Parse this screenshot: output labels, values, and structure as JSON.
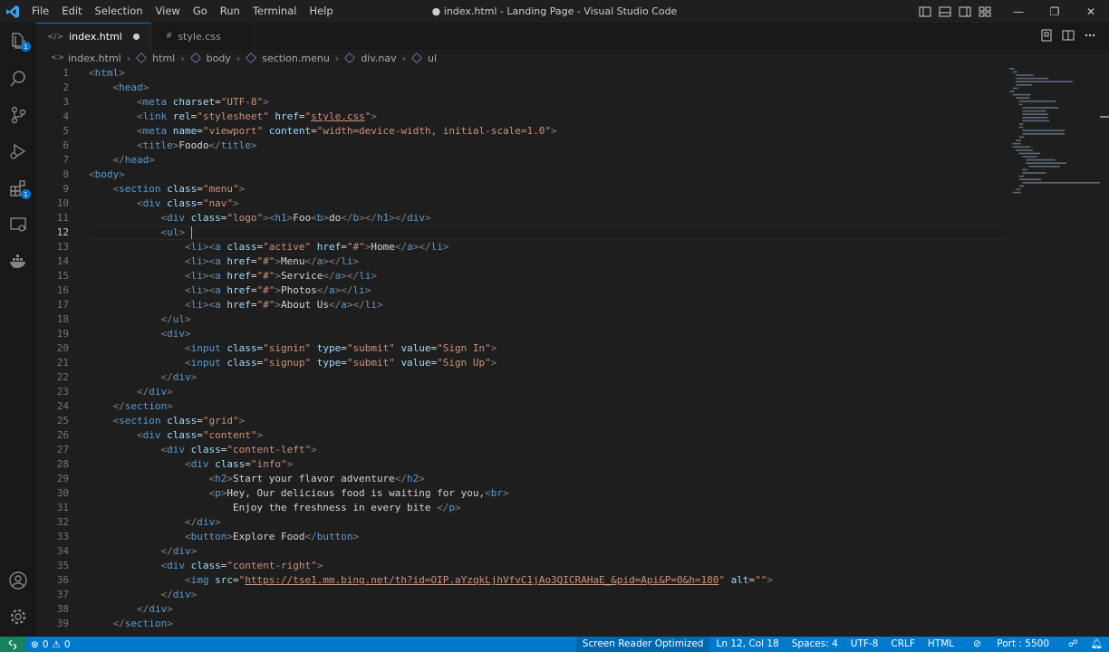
{
  "titlebar": {
    "menu": [
      "File",
      "Edit",
      "Selection",
      "View",
      "Go",
      "Run",
      "Terminal",
      "Help"
    ],
    "window_title": "● index.html - Landing Page - Visual Studio Code",
    "controls": [
      "minimize-icon",
      "restore-icon",
      "close-icon"
    ]
  },
  "activitybar": {
    "items": [
      "explorer-icon",
      "search-icon",
      "source-control-icon",
      "run-debug-icon",
      "extensions-icon",
      "remote-explorer-icon",
      "docker-icon"
    ],
    "explorer_badge": "1",
    "extensions_badge": "1",
    "bottom": [
      "accounts-icon",
      "settings-gear-icon"
    ]
  },
  "tabs": [
    {
      "label": "index.html",
      "icon": "</>",
      "modified": true,
      "active": true
    },
    {
      "label": "style.css",
      "icon": "#",
      "modified": false,
      "active": false
    }
  ],
  "breadcrumb": [
    "index.html",
    "html",
    "body",
    "section.menu",
    "div.nav",
    "ul"
  ],
  "editor": {
    "cursor_line": 12,
    "lines": [
      "<html>",
      "    <head>",
      "        <meta charset=\"UTF-8\">",
      "        <link rel=\"stylesheet\" href=\"style.css\">",
      "        <meta name=\"viewport\" content=\"width=device-width, initial-scale=1.0\">",
      "        <title>Foodo</title>",
      "    </head>",
      "<body>",
      "    <section class=\"menu\">",
      "        <div class=\"nav\">",
      "            <div class=\"logo\"><h1>Foo<b>do</b></h1></div>",
      "            <ul> ",
      "                <li><a class=\"active\" href=\"#\">Home</a></li>",
      "                <li><a href=\"#\">Menu</a></li>",
      "                <li><a href=\"#\">Service</a></li>",
      "                <li><a href=\"#\">Photos</a></li>",
      "                <li><a href=\"#\">About Us</a></li>",
      "            </ul>",
      "            <div>",
      "                <input class=\"signin\" type=\"submit\" value=\"Sign In\">",
      "                <input class=\"signup\" type=\"submit\" value=\"Sign Up\">",
      "            </div>",
      "        </div>",
      "    </section>",
      "    <section class=\"grid\">",
      "        <div class=\"content\">",
      "            <div class=\"content-left\">",
      "                <div class=\"info\">",
      "                    <h2>Start your flavor adventure</h2>",
      "                    <p>Hey, Our delicious food is waiting for you,<br>",
      "                        Enjoy the freshness in every bite </p>",
      "                </div>",
      "                <button>Explore Food</button>",
      "            </div>",
      "            <div class=\"content-right\">",
      "                <img src=\"https://tse1.mm.bing.net/th?id=OIP.aYzqkLjhVfvC1jAo3QICRAHaE_&pid=Api&P=0&h=180\" alt=\"\">",
      "            </div>",
      "        </div>",
      "    </section>"
    ]
  },
  "statusbar": {
    "problems_errors": "0",
    "problems_warnings": "0",
    "screen_reader": "Screen Reader Optimized",
    "position": "Ln 12, Col 18",
    "spaces": "Spaces: 4",
    "encoding": "UTF-8",
    "eol": "CRLF",
    "language": "HTML",
    "port": "Port : 5500"
  },
  "colors": {
    "accent": "#007acc",
    "tag": "#569cd6",
    "attr": "#9cdcfe",
    "string": "#ce9178",
    "bracket": "#808080"
  }
}
